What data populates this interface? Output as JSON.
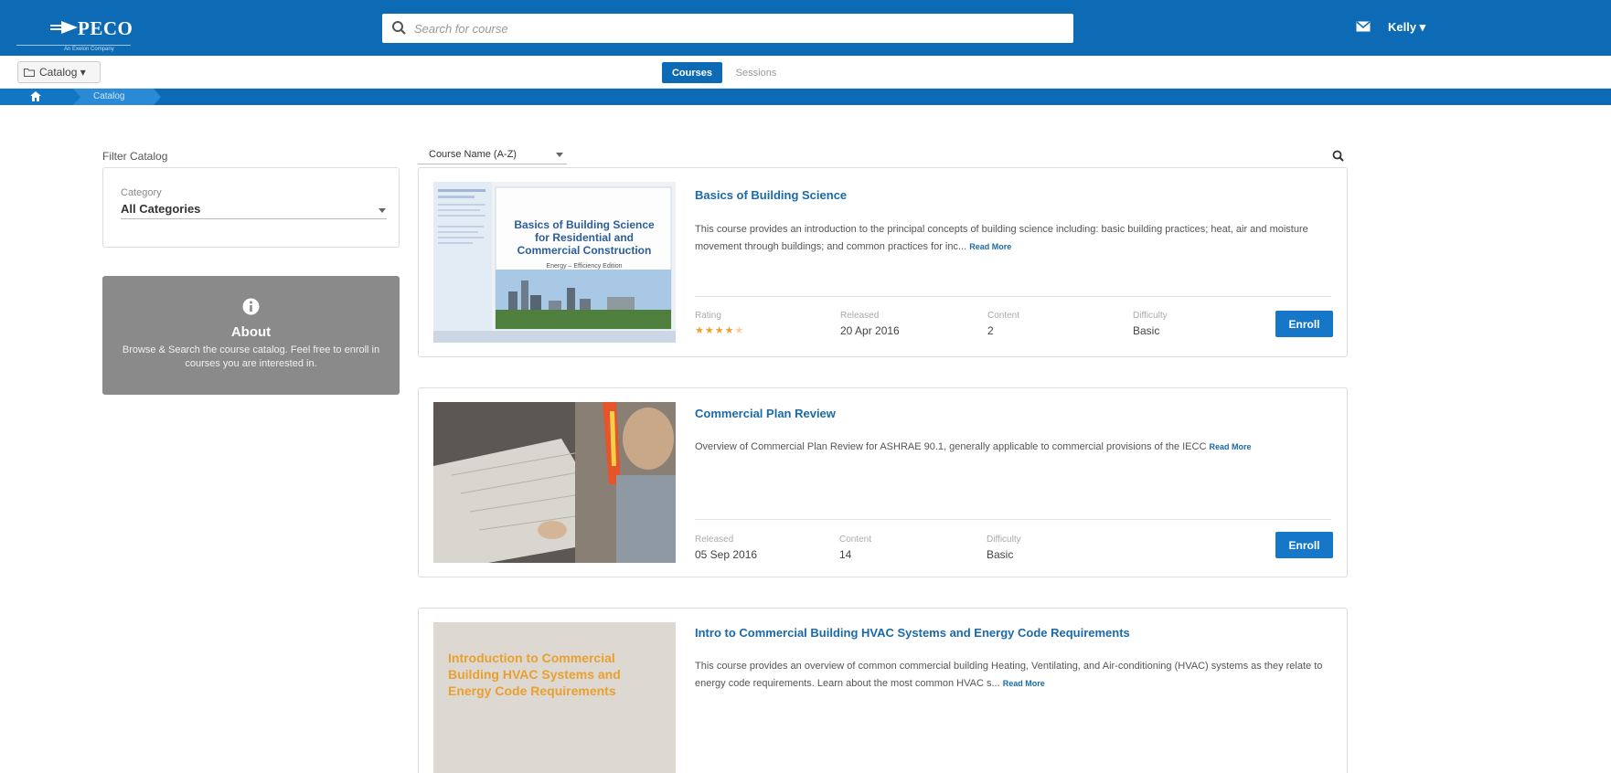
{
  "header": {
    "logo_text": "PECO",
    "logo_subtext": "An Exelon Company",
    "search_placeholder": "Search for course",
    "user_name": "Kelly ▾"
  },
  "nav": {
    "catalog_label": "Catalog ▾",
    "tabs": [
      {
        "label": "Courses",
        "active": true
      },
      {
        "label": "Sessions",
        "active": false
      }
    ]
  },
  "breadcrumb": {
    "current": "Catalog"
  },
  "sidebar": {
    "filter_title": "Filter Catalog",
    "category_label": "Category",
    "category_value": "All Categories",
    "about_title": "About",
    "about_text": "Browse & Search the course catalog. Feel free to enroll in courses you are interested in."
  },
  "list": {
    "sort_value": "Course Name (A-Z)"
  },
  "courses": [
    {
      "title": "Basics of Building Science",
      "description": "This course provides an introduction to the principal concepts of building science including: basic building practices; heat, air and moisture movement through buildings; and common practices for inc...",
      "read_more": "Read More",
      "image_title": "Basics of Building Science for Residential and Commercial Construction",
      "image_subtitle": "Energy – Efficiency Edition",
      "rating_label": "Rating",
      "rating": 4.5,
      "released_label": "Released",
      "released": "20 Apr 2016",
      "content_label": "Content",
      "content": "2",
      "difficulty_label": "Difficulty",
      "difficulty": "Basic",
      "enroll_label": "Enroll"
    },
    {
      "title": "Commercial Plan Review",
      "description": "Overview of Commercial Plan Review for ASHRAE 90.1, generally applicable to commercial provisions of the IECC",
      "read_more": "Read More",
      "released_label": "Released",
      "released": "05 Sep 2016",
      "content_label": "Content",
      "content": "14",
      "difficulty_label": "Difficulty",
      "difficulty": "Basic",
      "enroll_label": "Enroll"
    },
    {
      "title": "Intro to Commercial Building HVAC Systems and Energy Code Requirements",
      "description": "This course provides an overview of common commercial building Heating, Ventilating, and Air-conditioning (HVAC) systems as they relate to energy code requirements. Learn about the most common HVAC s...",
      "read_more": "Read More",
      "image_title": "Introduction to Commercial Building HVAC Systems and Energy Code Requirements"
    }
  ],
  "colors": {
    "brand_blue": "#0c6bb4",
    "link_blue": "#1a6aaa",
    "button_blue": "#1677c9",
    "about_gray": "#8a8a8a",
    "star_orange": "#f0a030"
  }
}
